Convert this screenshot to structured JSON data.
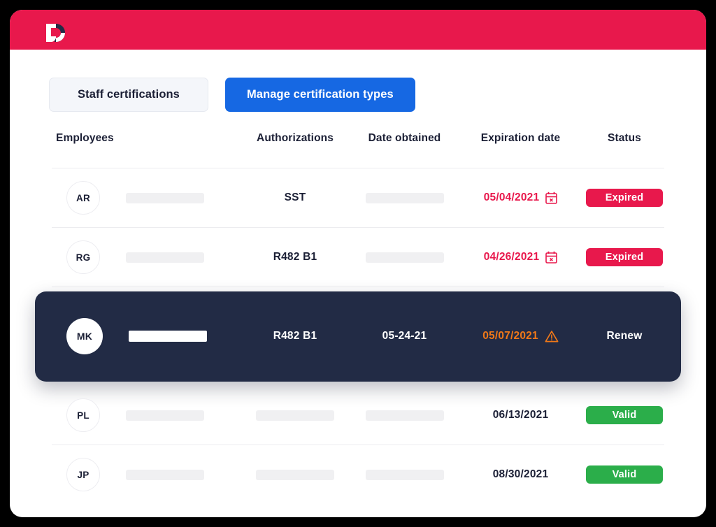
{
  "brand": {
    "logo_icon": "letter-d-logo",
    "bar_color": "#E8184C"
  },
  "toolbar": {
    "staff_certifications_label": "Staff certifications",
    "manage_types_label": "Manage certification types",
    "primary_color": "#1668E3",
    "secondary_bg": "#F4F6FA"
  },
  "table": {
    "columns": [
      "Employees",
      "Authorizations",
      "Date obtained",
      "Expiration date",
      "Status"
    ],
    "rows": [
      {
        "initials": "AR",
        "employee_name": "",
        "authorization": "SST",
        "date_obtained": "",
        "expiration_date": "05/04/2021",
        "expiration_state": "expired",
        "expiration_icon": "calendar-x-icon",
        "status": "Expired",
        "status_type": "expired",
        "highlighted": false
      },
      {
        "initials": "RG",
        "employee_name": "",
        "authorization": "R482 B1",
        "date_obtained": "",
        "expiration_date": "04/26/2021",
        "expiration_state": "expired",
        "expiration_icon": "calendar-x-icon",
        "status": "Expired",
        "status_type": "expired",
        "highlighted": false
      },
      {
        "initials": "MK",
        "employee_name": "",
        "authorization": "R482 B1",
        "date_obtained": "05-24-21",
        "expiration_date": "05/07/2021",
        "expiration_state": "warning",
        "expiration_icon": "warning-triangle-icon",
        "status": "Renew",
        "status_type": "renew",
        "highlighted": true
      },
      {
        "initials": "PL",
        "employee_name": "",
        "authorization": "",
        "date_obtained": "",
        "expiration_date": "06/13/2021",
        "expiration_state": "normal",
        "expiration_icon": "",
        "status": "Valid",
        "status_type": "valid",
        "highlighted": false
      },
      {
        "initials": "JP",
        "employee_name": "",
        "authorization": "",
        "date_obtained": "",
        "expiration_date": "08/30/2021",
        "expiration_state": "normal",
        "expiration_icon": "",
        "status": "Valid",
        "status_type": "valid",
        "highlighted": false
      }
    ]
  },
  "colors": {
    "expired_red": "#E8184C",
    "valid_green": "#2BAE4A",
    "warning_orange": "#F07818",
    "highlight_navy": "#222B45",
    "text_dark": "#1B1F35",
    "placeholder_gray": "#F0F0F2"
  }
}
